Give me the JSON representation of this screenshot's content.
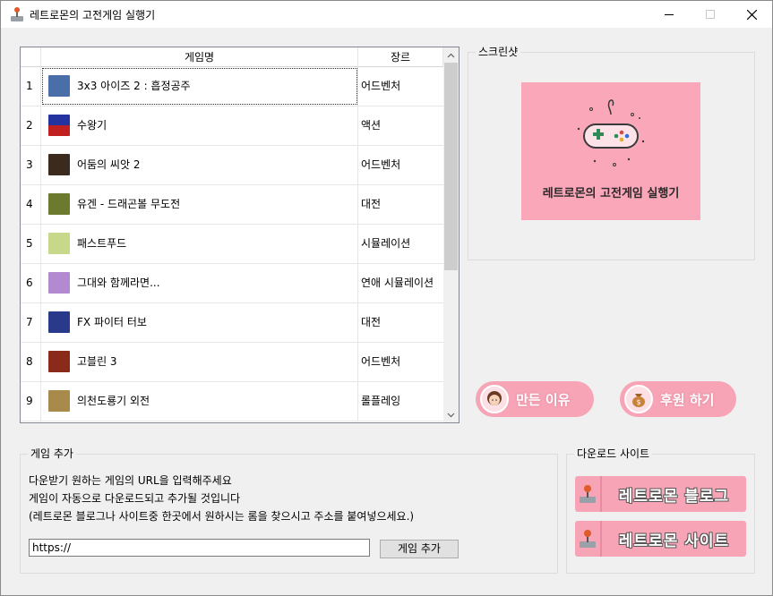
{
  "window": {
    "title": "레트로몬의 고전게임 실행기"
  },
  "table": {
    "headers": {
      "number": "",
      "name": "게임명",
      "genre": "장르"
    },
    "rows": [
      {
        "num": "1",
        "name": "3x3 아이즈 2 :  흡정공주",
        "genre": "어드벤처",
        "thumb": "#4a6fa8"
      },
      {
        "num": "2",
        "name": "수왕기",
        "genre": "액션",
        "thumb": "#2433a0"
      },
      {
        "num": "3",
        "name": "어둠의 씨앗 2",
        "genre": "어드벤처",
        "thumb": "#3b2a1e"
      },
      {
        "num": "4",
        "name": "유겐 - 드래곤볼 무도전",
        "genre": "대전",
        "thumb": "#6b7a2e"
      },
      {
        "num": "5",
        "name": "패스트푸드",
        "genre": "시뮬레이션",
        "thumb": "#c8d88a"
      },
      {
        "num": "6",
        "name": "그대와 함께라면...",
        "genre": "연애 시뮬레이션",
        "thumb": "#b38ad0"
      },
      {
        "num": "7",
        "name": "FX 파이터 터보",
        "genre": "대전",
        "thumb": "#2a3a8a"
      },
      {
        "num": "8",
        "name": "고블린 3",
        "genre": "어드벤처",
        "thumb": "#8a2a1a"
      },
      {
        "num": "9",
        "name": "의천도룡기 외전",
        "genre": "롤플레잉",
        "thumb": "#a88a4a"
      }
    ]
  },
  "screenshot": {
    "title": "스크린샷",
    "caption": "레트로몬의 고전게임 실행기"
  },
  "buttons": {
    "why_made": "만든 이유",
    "donate": "후원 하기"
  },
  "add_game": {
    "title": "게임 추가",
    "line1": "다운받기 원하는 게임의 URL을 입력해주세요",
    "line2": "게임이 자동으로 다운로드되고 추가될 것입니다",
    "line3": "(레트로몬 블로그나 사이트중 한곳에서 원하시는 롬을 찾으시고 주소를 붙여넣으세요.)",
    "url_value": "https://",
    "add_button": "게임 추가"
  },
  "download": {
    "title": "다운로드 사이트",
    "blog": "레트로몬 블로그",
    "site": "레트로몬 사이트"
  },
  "colors": {
    "pink": "#f6a4b6",
    "screenshot_bg": "#f9a7b9"
  }
}
